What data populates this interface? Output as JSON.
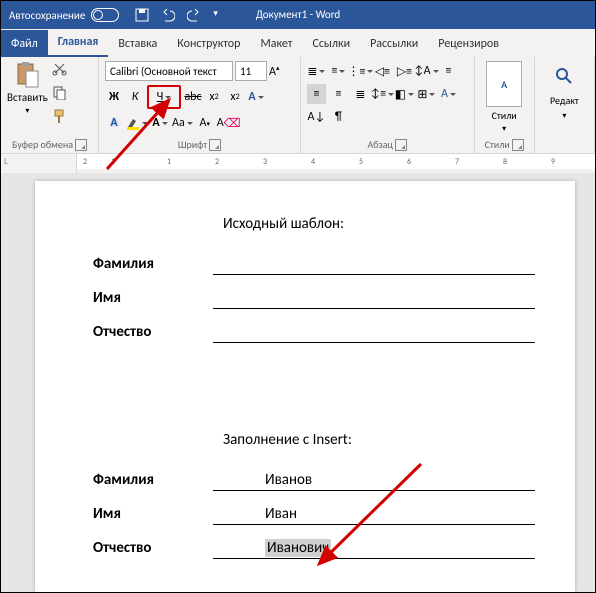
{
  "titlebar": {
    "autosave": "Автосохранение",
    "title": "Документ1 - Word"
  },
  "tabs": {
    "file": "Файл",
    "home": "Главная",
    "insert": "Вставка",
    "design": "Конструктор",
    "layout": "Макет",
    "references": "Ссылки",
    "mailings": "Рассылки",
    "review": "Рецензиров"
  },
  "ribbon": {
    "clipboard": {
      "label": "Буфер обмена",
      "paste": "Вставить"
    },
    "font": {
      "label": "Шрифт",
      "name": "Calibri (Основной текст",
      "size": "11",
      "bold": "Ж",
      "italic": "К",
      "underline": "Ч",
      "strike": "abc",
      "sub": "x",
      "sup": "x",
      "clear": "Aa",
      "case": "Aa"
    },
    "paragraph": {
      "label": "Абзац"
    },
    "styles": {
      "label": "Стили",
      "btn": "Стили"
    },
    "editing": {
      "label": "Редакт"
    }
  },
  "ruler": {
    "corner": "L",
    "marks": [
      " ",
      "1",
      "2",
      "1",
      "·",
      "·",
      "1",
      "·",
      "2",
      "·",
      "3",
      "·",
      "4",
      "·",
      "5",
      "·",
      "6",
      "·",
      "7",
      "·",
      "8",
      "·",
      "9"
    ]
  },
  "doc": {
    "section1": "Исходный шаблон:",
    "section2": "Заполнение с Insert:",
    "labels": {
      "surname": "Фамилия",
      "name": "Имя",
      "patronymic": "Отчество"
    },
    "values": {
      "surname": "Иванов",
      "name": "Иван",
      "patronymic": "Иванович"
    }
  }
}
